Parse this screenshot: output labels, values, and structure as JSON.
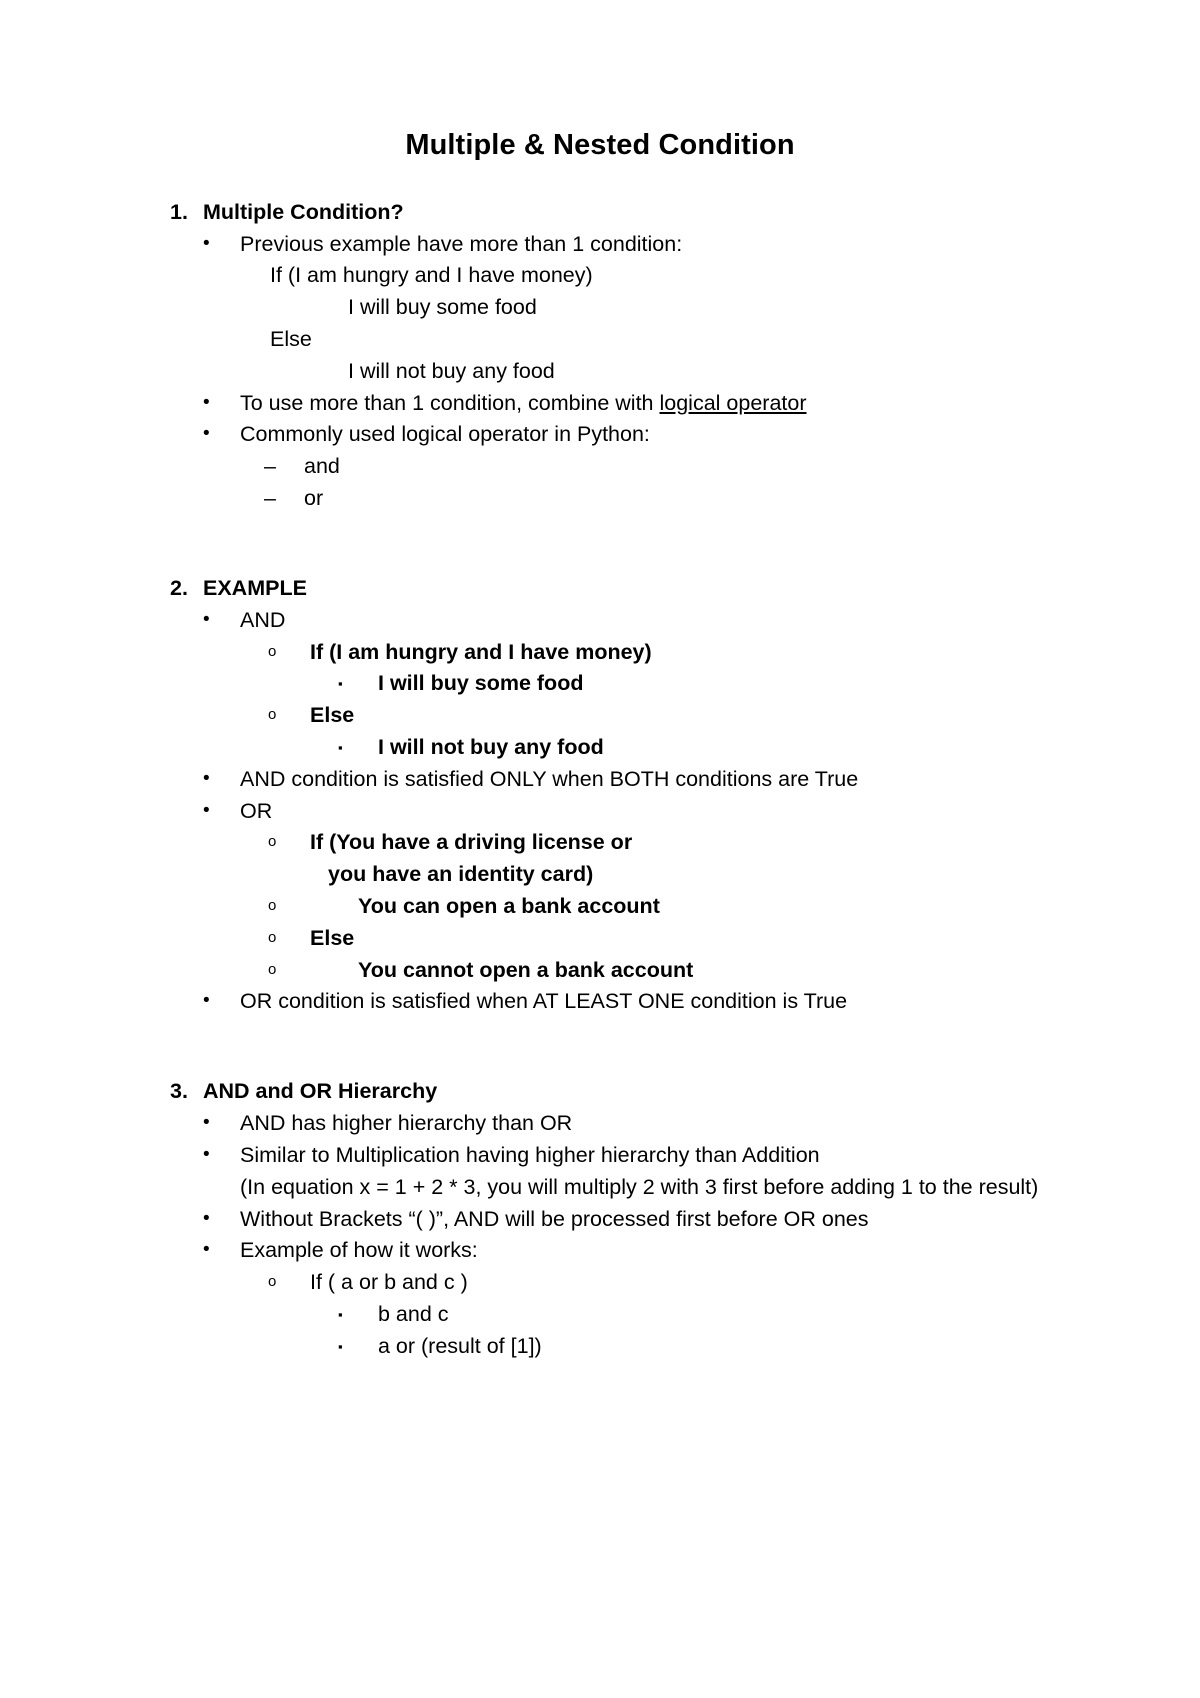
{
  "document": {
    "title": "Multiple & Nested Condition",
    "sections": [
      {
        "number": "1.",
        "heading": "Multiple Condition?",
        "items": {
          "b1_previous": "Previous example have more than 1 condition:",
          "code_if": "If (I am hungry and I have money)",
          "code_buy": "I will buy some food",
          "code_else": "Else",
          "code_notbuy": "I will not buy any food",
          "b1_touse_pre": "To use more than 1 condition, combine with ",
          "b1_touse_underlined": "logical operator",
          "b1_commonly": "Commonly used logical operator in Python:",
          "dash_and": "and",
          "dash_or": "or"
        }
      },
      {
        "number": "2.",
        "heading": "EXAMPLE",
        "items": {
          "b1_and": "AND",
          "b2_if_and": "If (I am hungry and I have money)",
          "b3_buy": "I will buy some food",
          "b2_else": "Else",
          "b3_notbuy": "I will not buy any food",
          "b1_and_rule": "AND condition is satisfied ONLY when BOTH conditions are True",
          "b1_or": "OR",
          "b2_if_or_line1": "If (You have a driving license or",
          "b2_if_or_line2": "you have an identity card)",
          "b2_can_open": "You can open a bank account",
          "b2_cannot_open": "You cannot open a bank account",
          "b1_or_rule": "OR condition is satisfied when AT LEAST ONE condition is True"
        }
      },
      {
        "number": "3.",
        "heading": "AND and OR Hierarchy",
        "items": {
          "b1_higher": "AND has higher hierarchy than OR",
          "b1_similar": "Similar to Multiplication having higher hierarchy than Addition",
          "b1_similar_cont": "(In equation x = 1 + 2 * 3, you will multiply 2 with 3 first before adding 1 to the result)",
          "b1_without_brackets": "Without Brackets “( )”, AND will be processed first before OR ones",
          "b1_example": "Example of how it works:",
          "b2_if_abc": "If ( a or b and c )",
          "b3_b_and_c": "b and c",
          "b3_a_or_result": "a or (result of [1])"
        }
      }
    ],
    "glyphs": {
      "bullet_disc": "•",
      "bullet_circle": "o",
      "bullet_square": "▪",
      "bullet_dash": "–"
    }
  }
}
